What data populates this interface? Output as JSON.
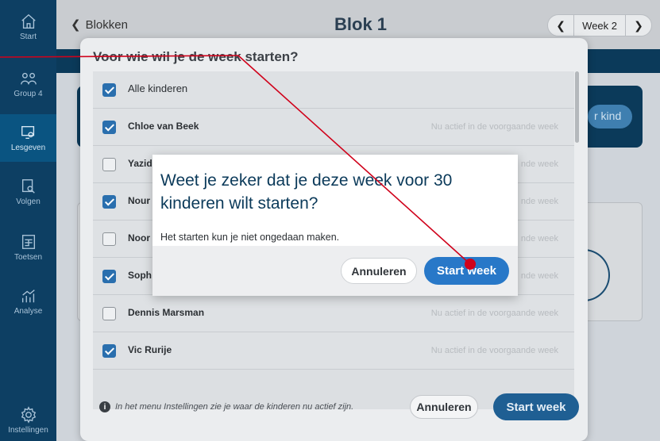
{
  "sidebar": {
    "items": [
      {
        "label": "Start",
        "icon": "home-icon"
      },
      {
        "label": "Group 4",
        "icon": "group-icon"
      },
      {
        "label": "Lesgeven",
        "icon": "teach-icon",
        "active": true
      },
      {
        "label": "Volgen",
        "icon": "follow-icon"
      },
      {
        "label": "Toetsen",
        "icon": "test-icon"
      },
      {
        "label": "Analyse",
        "icon": "analysis-icon"
      },
      {
        "label": "Instellingen",
        "icon": "gear-icon"
      }
    ]
  },
  "header": {
    "back_label": "Blokken",
    "title": "Blok 1",
    "week_label": "Week 2"
  },
  "background": {
    "pill_text": "r kind"
  },
  "modal": {
    "title": "Voor wie wil je de week starten?",
    "rows": [
      {
        "name": "Alle kinderen",
        "checked": true,
        "status": ""
      },
      {
        "name": "Chloe van Beek",
        "checked": true,
        "status": "Nu actief in de voorgaande week"
      },
      {
        "name": "Yazid",
        "checked": false,
        "status": "nde week"
      },
      {
        "name": "Nour",
        "checked": true,
        "status": "nde week"
      },
      {
        "name": "Noor",
        "checked": false,
        "status": "nde week"
      },
      {
        "name": "Soph",
        "checked": true,
        "status": "nde week"
      },
      {
        "name": "Dennis Marsman",
        "checked": false,
        "status": "Nu actief in de voorgaande week"
      },
      {
        "name": "Vic Rurije",
        "checked": true,
        "status": "Nu actief in de voorgaande week"
      }
    ],
    "footer_info": "In het menu Instellingen zie je waar de kinderen nu actief zijn.",
    "cancel_label": "Annuleren",
    "start_label": "Start week"
  },
  "confirm": {
    "title": "Weet je zeker dat je deze week voor 30 kinderen wilt starten?",
    "message": "Het starten kun je niet ongedaan maken.",
    "cancel_label": "Annuleren",
    "start_label": "Start week"
  },
  "colors": {
    "sidebar": "#0d3f63",
    "primary": "#2878c8",
    "pointer": "#d0021b"
  }
}
